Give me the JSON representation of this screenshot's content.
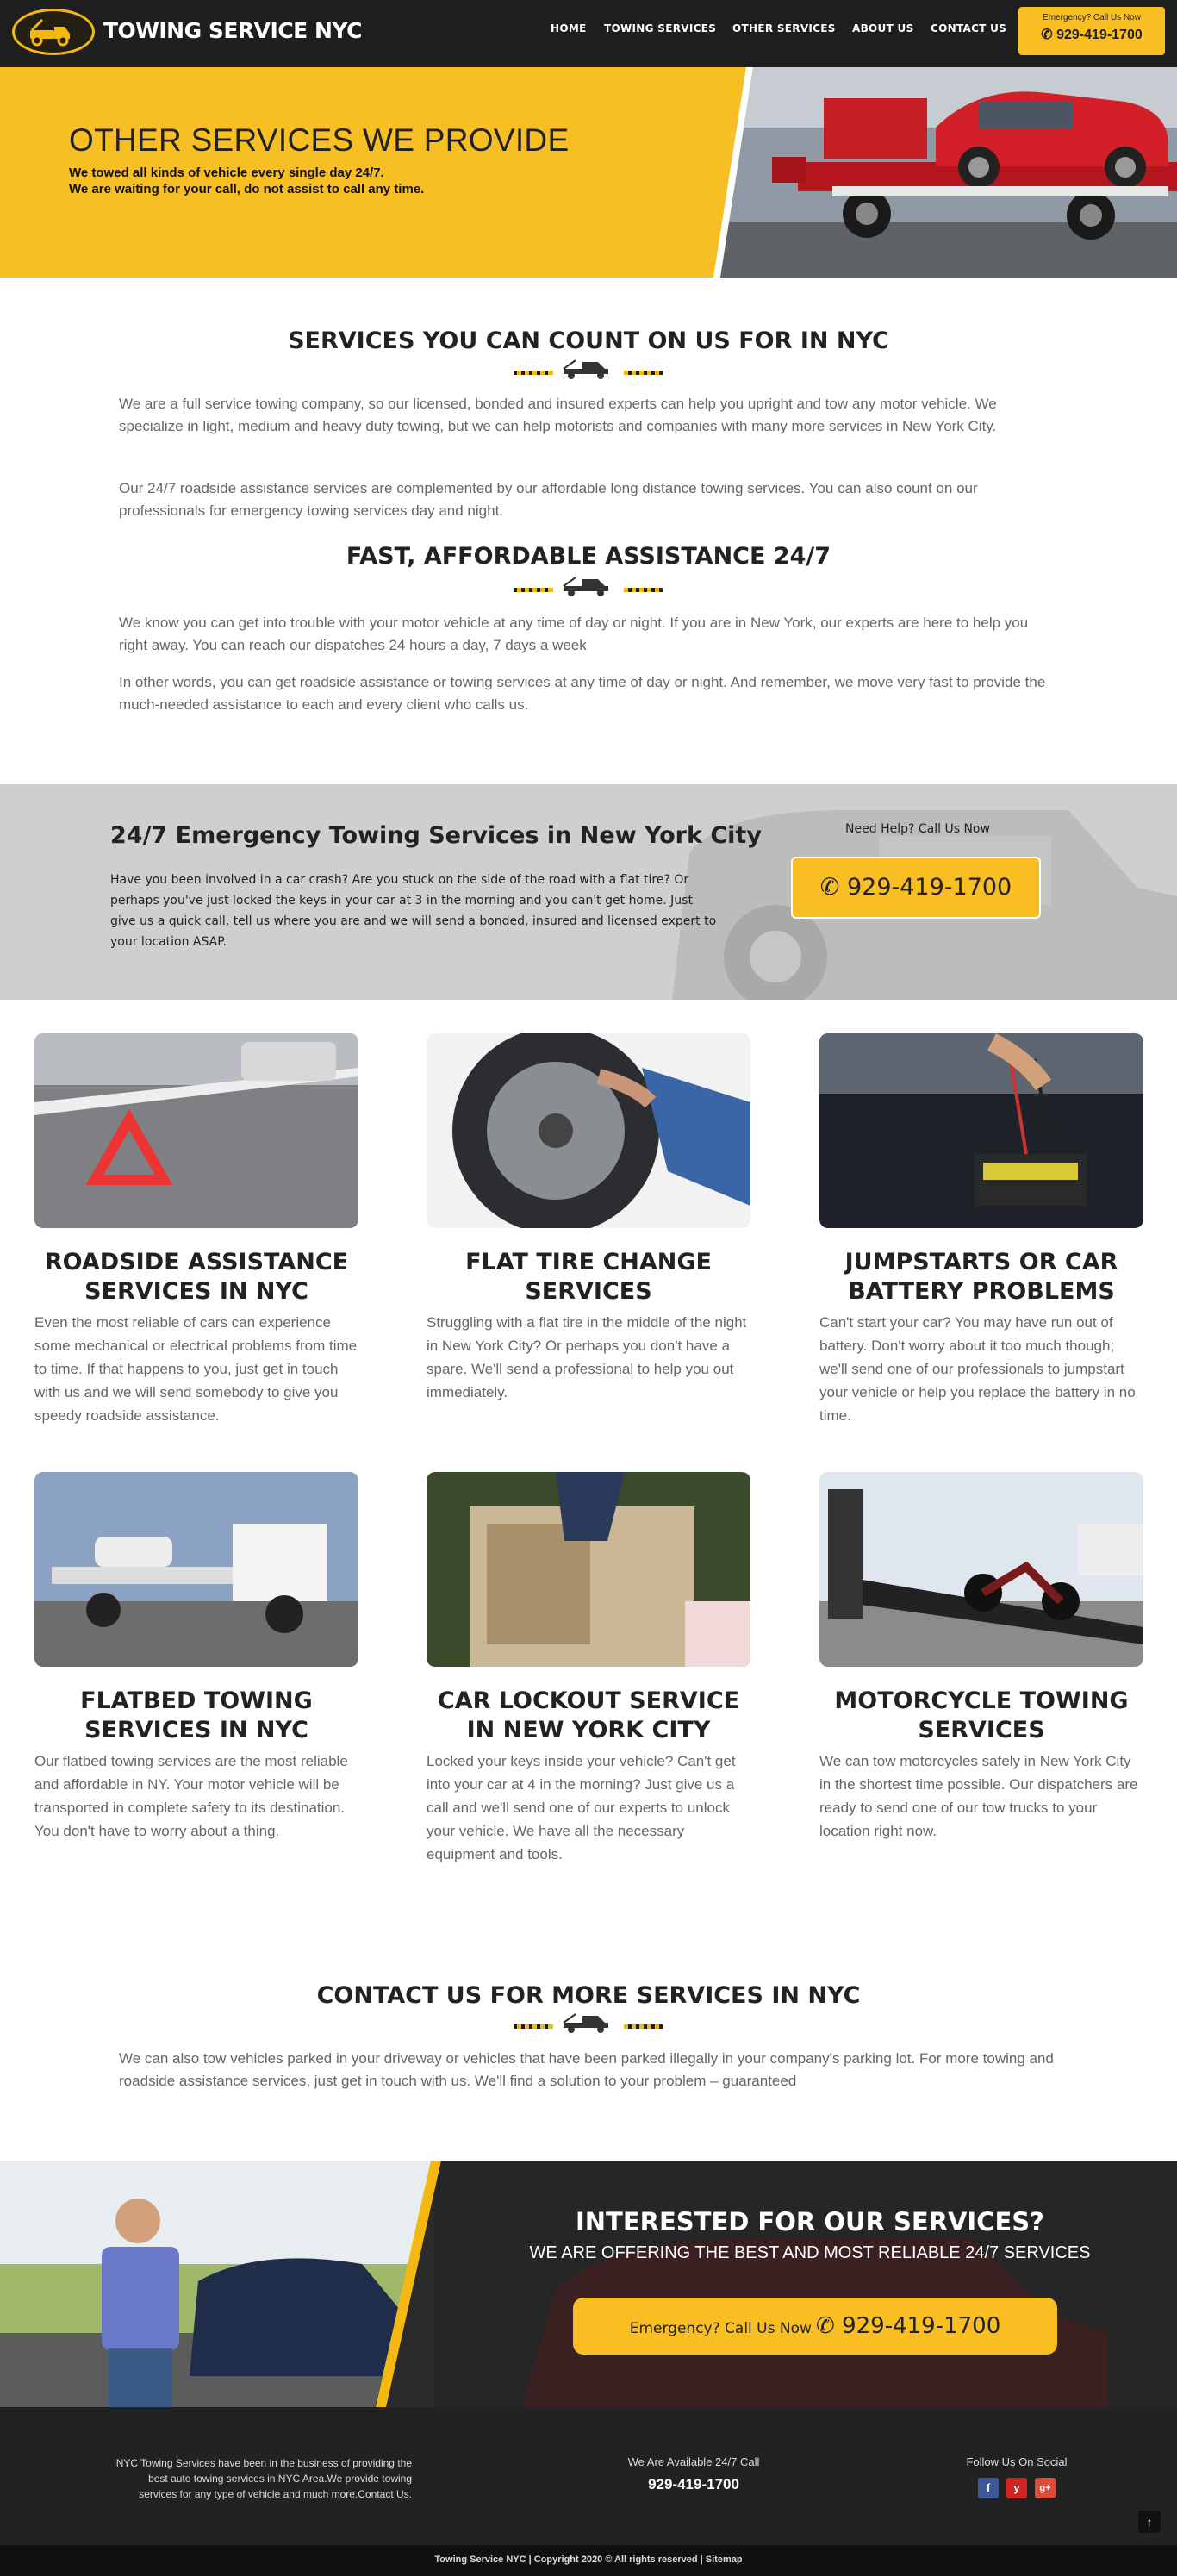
{
  "header": {
    "logo_text": "TOWING SERVICE NYC",
    "nav": [
      "HOME",
      "TOWING SERVICES",
      "OTHER SERVICES",
      "ABOUT US",
      "CONTACT US"
    ],
    "call_label": "Emergency? Call Us Now",
    "call_number": "929-419-1700"
  },
  "hero": {
    "title": "OTHER SERVICES WE PROVIDE",
    "line1": "We towed all kinds of vehicle every single day 24/7.",
    "line2": "We are waiting for your call, do not assist to call any time."
  },
  "section1": {
    "heading": "SERVICES YOU CAN COUNT ON US FOR IN NYC",
    "p1": "We are a full service towing company, so our licensed, bonded and insured experts can help you upright and tow any motor vehicle. We specialize in light, medium and heavy duty towing, but we can help motorists and companies with many more services in New York City.",
    "p2": "Our 24/7 roadside assistance services are complemented by our affordable long distance towing services. You can also count on our professionals for emergency towing services day and night."
  },
  "section2": {
    "heading": "FAST, AFFORDABLE ASSISTANCE 24/7",
    "p1": "We know you can get into trouble with your motor vehicle at any time of day or night. If you are in New York, our experts are here to help you right away. You can reach our dispatches 24 hours a day, 7 days a week",
    "p2": "In other words, you can get roadside assistance or towing services at any time of day or night. And remember, we move very fast to provide the much-needed assistance to each and every client who calls us."
  },
  "emergency": {
    "heading": "24/7 Emergency Towing Services in New York City",
    "text": "Have you been involved in a car crash? Are you stuck on the side of the road with a flat tire? Or perhaps you've just locked the keys in your car at 3 in the morning and you can't get home. Just give us a quick call, tell us where you are and we will send a bonded, insured and licensed expert to your location ASAP.",
    "need_help": "Need Help? Call Us Now",
    "phone": "929-419-1700"
  },
  "services": [
    {
      "title": "ROADSIDE ASSISTANCE SERVICES IN NYC",
      "text": "Even the most reliable of cars can experience some mechanical or electrical problems from time to time. If that happens to you, just get in touch with us and we will send somebody to give you speedy roadside assistance."
    },
    {
      "title": "FLAT TIRE CHANGE SERVICES",
      "text": "Struggling with a flat tire in the middle of the night in New York City? Or perhaps you don't have a spare. We'll send a professional to help you out immediately."
    },
    {
      "title": "JUMPSTARTS OR CAR BATTERY PROBLEMS",
      "text": "Can't start your car? You may have run out of battery. Don't worry about it too much though; we'll send one of our professionals to jumpstart your vehicle or help you replace the battery in no time."
    },
    {
      "title": "FLATBED TOWING SERVICES IN NYC",
      "text": "Our flatbed towing services are the most reliable and affordable in NY. Your motor vehicle will be transported in complete safety to its destination. You don't have to worry about a thing."
    },
    {
      "title": "CAR LOCKOUT SERVICE IN NEW YORK CITY",
      "text": "Locked your keys inside your vehicle? Can't get into your car at 4 in the morning? Just give us a call and we'll send one of our experts to unlock your vehicle. We have all the necessary equipment and tools."
    },
    {
      "title": "MOTORCYCLE TOWING SERVICES",
      "text": "We can tow motorcycles safely in New York City in the shortest time possible. Our dispatchers are ready to send one of our tow trucks to your location right now."
    }
  ],
  "contact": {
    "heading": "CONTACT US FOR MORE SERVICES IN NYC",
    "text": "We can also tow vehicles parked in your driveway or vehicles that have been parked illegally in your company's parking lot. For more towing and roadside assistance services, just get in touch with us. We'll find a solution to your problem – guaranteed"
  },
  "cta": {
    "heading": "INTERESTED FOR OUR SERVICES?",
    "sub": "WE ARE OFFERING THE BEST AND MOST RELIABLE 24/7 SERVICES",
    "btn_label": "Emergency? Call Us Now",
    "btn_number": "929-419-1700"
  },
  "footer": {
    "about": "NYC Towing Services have been in the business of providing the best auto towing services in NYC Area.We provide towing services for any type of vehicle and much more.Contact Us.",
    "available": "We Are Available 24/7 Call",
    "phone": "929-419-1700",
    "follow": "Follow Us On Social",
    "social": [
      "f",
      "y",
      "g+"
    ],
    "copyright": "Towing Service NYC | Copyright 2020 © All rights reserved | Sitemap",
    "back_to_top": "↑"
  },
  "colors": {
    "accent": "#f8be22",
    "dark": "#1e1e1e",
    "text": "#666666"
  }
}
